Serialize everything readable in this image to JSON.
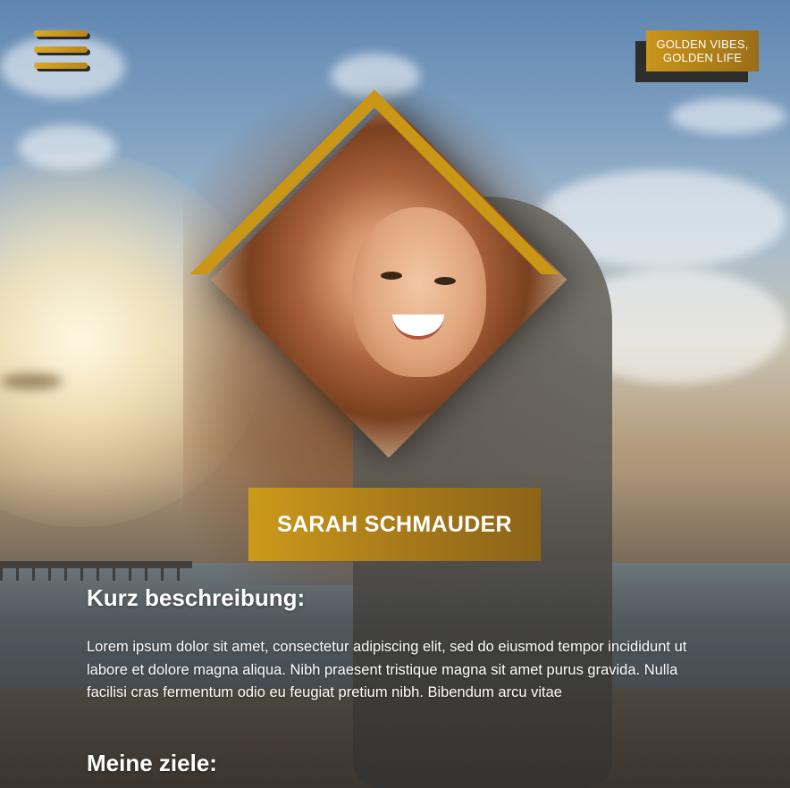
{
  "header": {
    "menu_icon": "hamburger-menu-icon",
    "badge_text": "GOLDEN VIBES, GOLDEN LIFE"
  },
  "profile": {
    "name": "SARAH SCHMAUDER"
  },
  "sections": {
    "description_title": "Kurz beschreibung:",
    "description_text": "Lorem ipsum dolor sit amet, consectetur adipiscing elit, sed do eiusmod tempor incididunt ut labore et dolore magna aliqua. Nibh praesent tristique magna sit amet purus gravida. Nulla facilisi cras fermentum odio eu feugiat pretium nibh. Bibendum arcu vitae",
    "goals_title": "Meine ziele:"
  },
  "colors": {
    "accent_gold": "#c99616",
    "accent_dark_gold": "#8c6418",
    "shadow": "#2d2d2b",
    "text": "#ffffff"
  }
}
